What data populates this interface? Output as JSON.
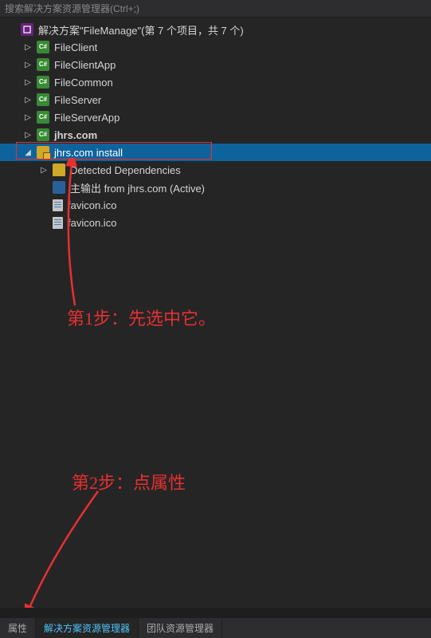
{
  "search": {
    "placeholder": "搜索解决方案资源管理器(Ctrl+;)"
  },
  "solution": {
    "label": "解决方案\"FileManage\"(第 7 个项目，共 7 个)"
  },
  "projects": {
    "fileClient": "FileClient",
    "fileClientApp": "FileClientApp",
    "fileCommon": "FileCommon",
    "fileServer": "FileServer",
    "fileServerApp": "FileServerApp",
    "jhrsCom": "jhrs.com",
    "jhrsInstall": "jhrs.com install"
  },
  "installerItems": {
    "dependencies": "Detected Dependencies",
    "output": "主输出 from jhrs.com (Active)",
    "favicon1": "favicon.ico",
    "favicon2": "favicon.ico"
  },
  "annotations": {
    "step1": "第1步：先选中它。",
    "step2": "第2步：点属性"
  },
  "tabs": {
    "properties": "属性",
    "solutionExplorer": "解决方案资源管理器",
    "teamExplorer": "团队资源管理器"
  }
}
